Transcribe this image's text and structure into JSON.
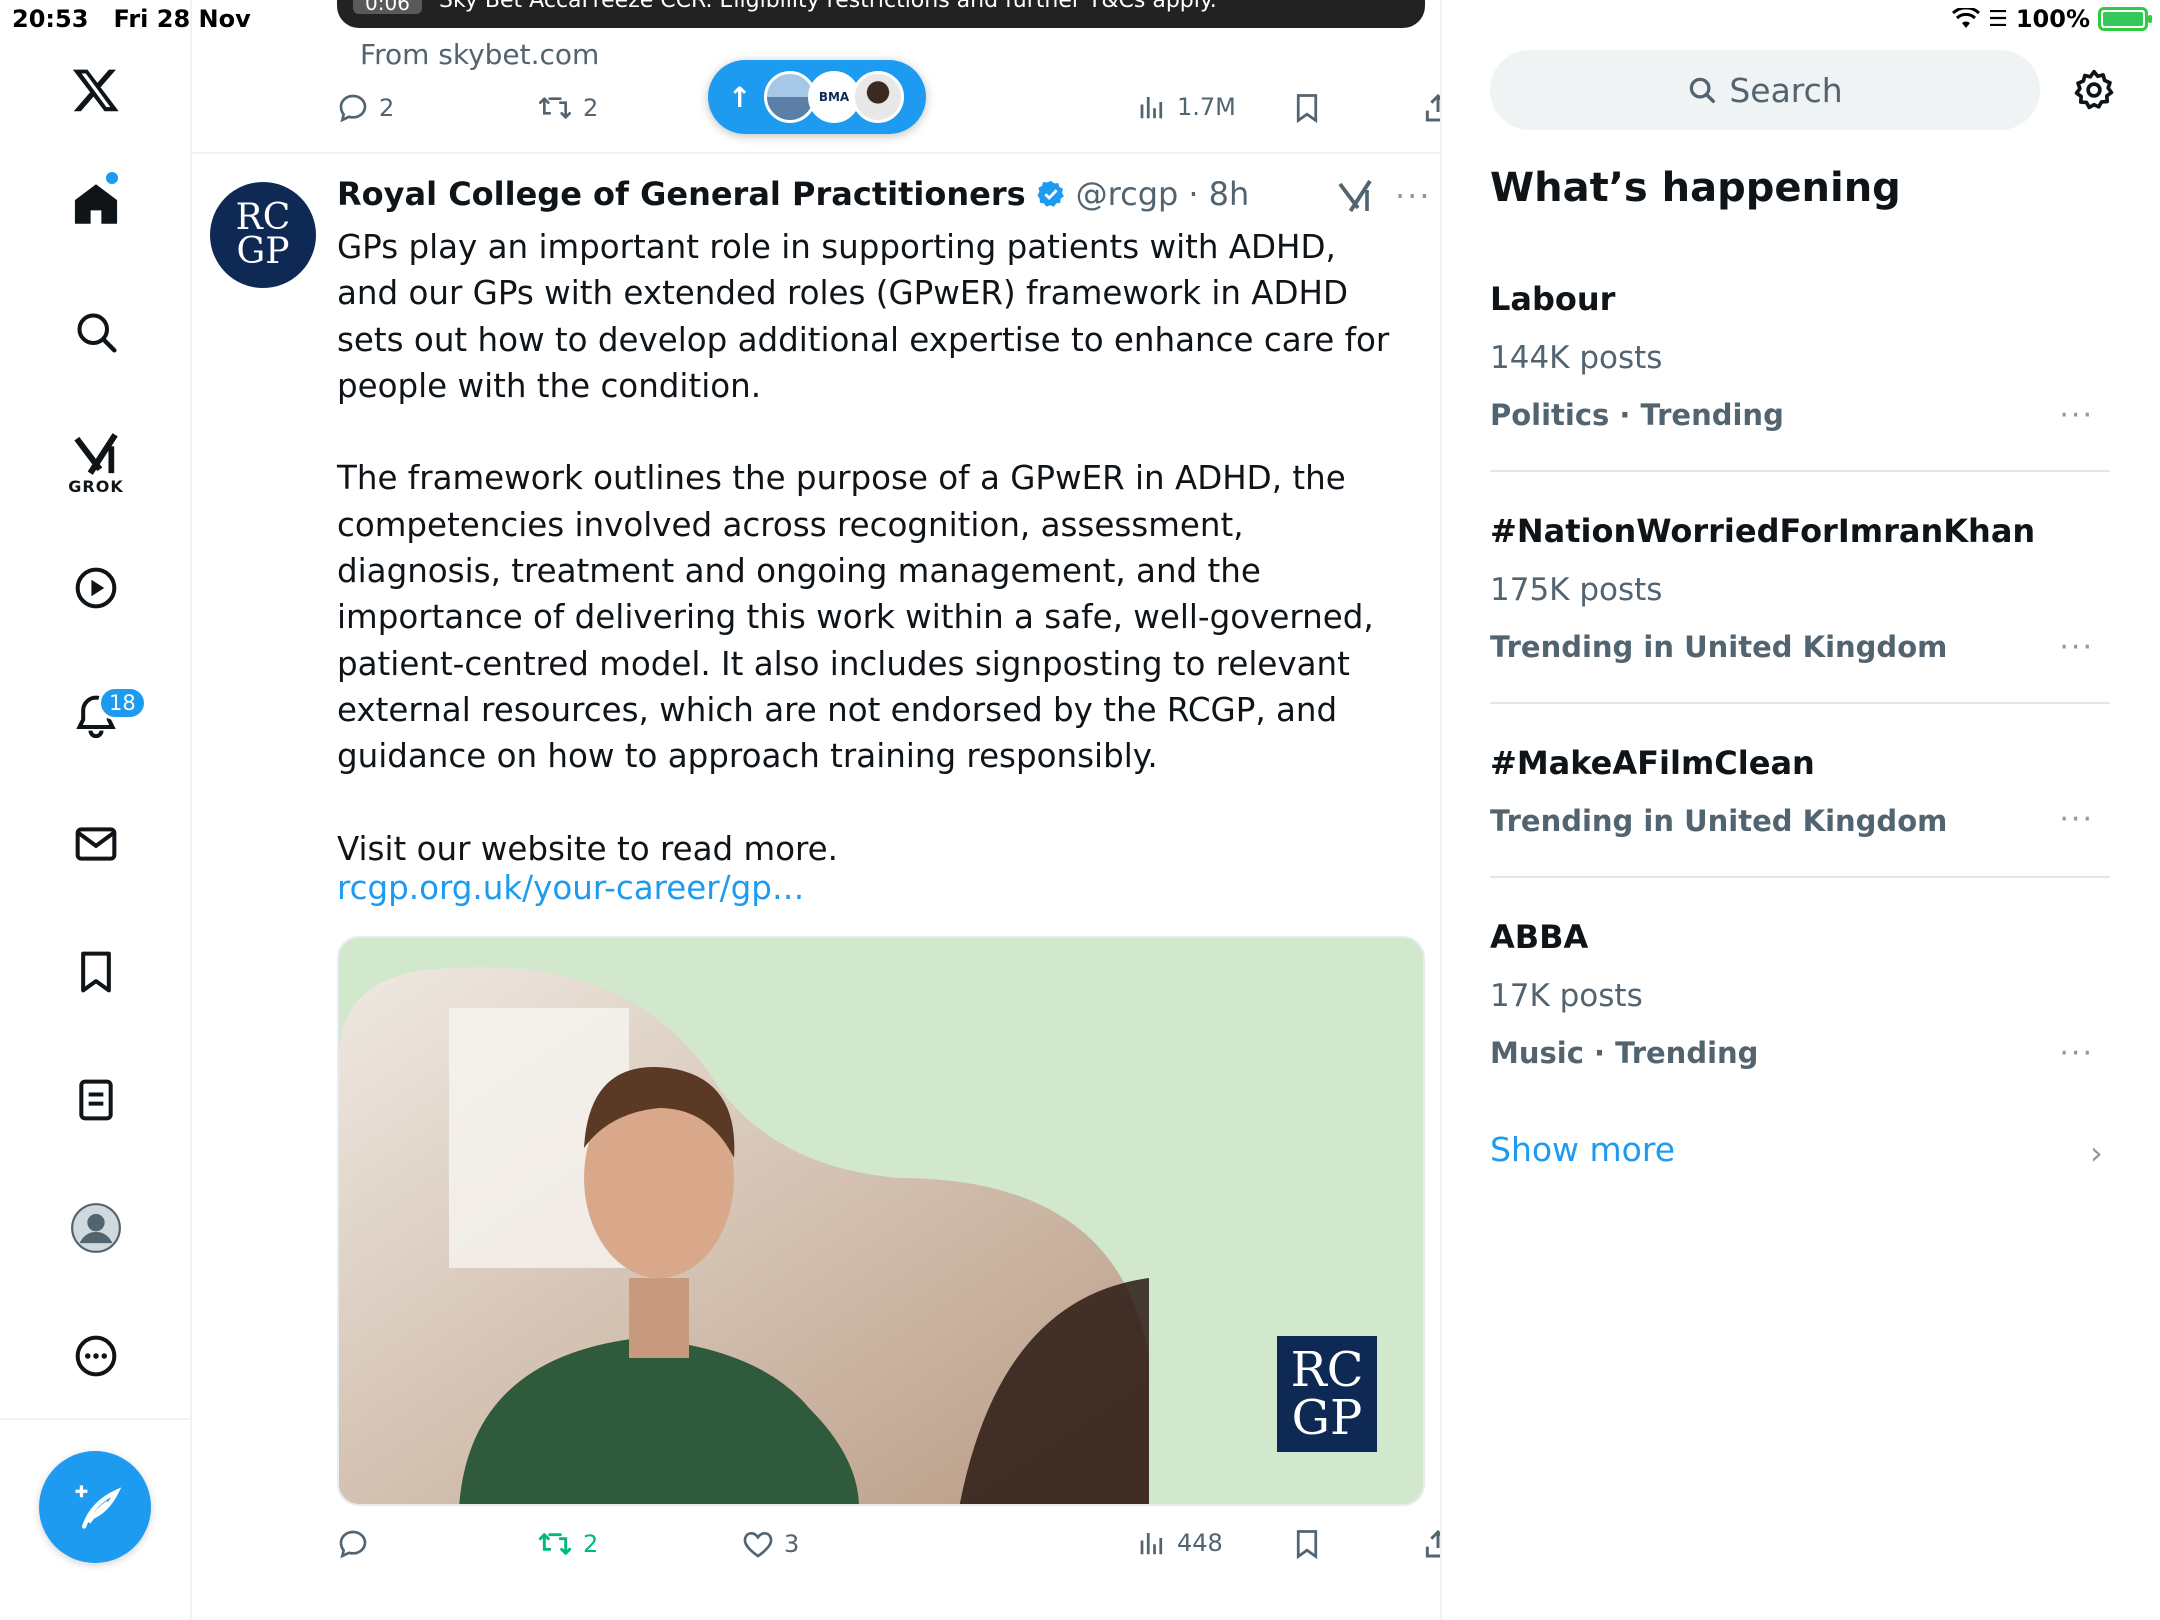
{
  "status_bar": {
    "time": "20:53",
    "date": "Fri 28 Nov",
    "battery": "100%",
    "battery_level": 1.0
  },
  "nav": {
    "grok_label": "GROK",
    "notifications_count": "18"
  },
  "previous_post": {
    "video_time": "0:06",
    "video_caption": "Sky Bet AccaFreeze CCR. Eligibility restrictions and further T&Cs apply.",
    "source": "From skybet.com",
    "replies": "2",
    "reposts": "2",
    "views": "1.7M"
  },
  "new_posts_pill": {
    "arrow": "↑",
    "avatar_label": "BMA"
  },
  "tweet": {
    "author_name": "Royal College of General Practitioners",
    "handle": "@rcgp",
    "time": "· 8h",
    "avatar_text_line1": "RC",
    "avatar_text_line2": "GP",
    "body": "GPs play an important role in supporting patients with ADHD, and our GPs with extended roles (GPwER) framework in ADHD sets out how to develop additional expertise to enhance care for people with the condition.\n\nThe framework outlines the purpose of a GPwER in ADHD, the competencies involved across recognition, assessment, diagnosis, treatment and ongoing management, and the importance of delivering this work within a safe, well-governed, patient-centred model. It also includes signposting to relevant external resources, which are not endorsed by the RCGP, and guidance on how to approach training responsibly.\n\nVisit our website to read more.",
    "link": "rcgp.org.uk/your-career/gp…",
    "image_logo_line1": "RC",
    "image_logo_line2": "GP",
    "reposts": "2",
    "likes": "3",
    "views": "448"
  },
  "sidebar": {
    "search_placeholder": "Search",
    "section_title": "What’s happening",
    "trends": [
      {
        "title": "Labour",
        "count": "144K posts",
        "category": "Politics · Trending"
      },
      {
        "title": "#NationWorriedForImranKhan",
        "count": "175K posts",
        "category": "Trending in United Kingdom"
      },
      {
        "title": "#MakeAFilmClean",
        "count": "",
        "category": "Trending in United Kingdom"
      },
      {
        "title": "ABBA",
        "count": "17K posts",
        "category": "Music · Trending"
      }
    ],
    "show_more": "Show more"
  },
  "colors": {
    "accent": "#1d9bf0",
    "repost_green": "#00ba7c",
    "muted_text": "#536471",
    "rcgp_navy": "#0e2a54",
    "image_bg": "#d2e8cd"
  },
  "icons": [
    "x-logo-icon",
    "home-icon",
    "search-icon",
    "grok-icon",
    "video-icon",
    "bell-icon",
    "mail-icon",
    "bookmark-icon",
    "lists-icon",
    "profile-icon",
    "more-icon",
    "compose-icon",
    "reply-icon",
    "repost-icon",
    "like-icon",
    "views-icon",
    "share-icon",
    "verified-icon",
    "gear-icon",
    "chevron-right-icon"
  ]
}
